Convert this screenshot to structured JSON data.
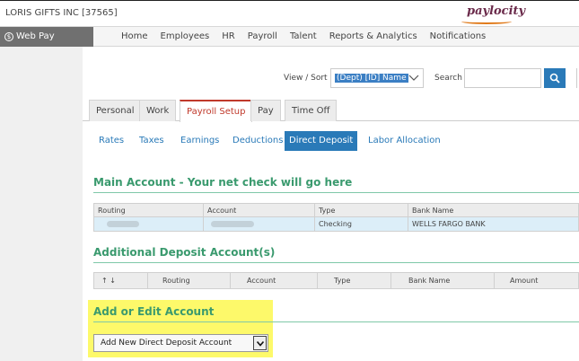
{
  "header": {
    "company": "LORIS GIFTS INC [37565]",
    "logo": "paylocity"
  },
  "navbar": {
    "product": "Web Pay",
    "items": [
      "Home",
      "Employees",
      "HR",
      "Payroll",
      "Talent",
      "Reports & Analytics",
      "Notifications"
    ]
  },
  "toolbar": {
    "view_sort_label": "View / Sort",
    "view_sort_value": "(Dept) [ID] Name",
    "search_label": "Search",
    "search_value": ""
  },
  "tabs": [
    "Personal",
    "Work",
    "Payroll Setup",
    "Pay",
    "Time Off"
  ],
  "active_tab": "Payroll Setup",
  "subtabs": [
    "Rates",
    "Taxes",
    "Earnings",
    "Deductions",
    "Direct Deposit",
    "Labor Allocation"
  ],
  "active_subtab": "Direct Deposit",
  "main_account": {
    "title": "Main Account - Your net check will go here",
    "columns": [
      "Routing",
      "Account",
      "Type",
      "Bank Name"
    ],
    "rows": [
      {
        "type": "Checking",
        "bank_name": "WELLS FARGO BANK"
      }
    ]
  },
  "additional_accounts": {
    "title": "Additional Deposit Account(s)",
    "sort_label": "↑ ↓",
    "columns": [
      "Routing",
      "Account",
      "Type",
      "Bank Name",
      "Amount"
    ]
  },
  "add_edit": {
    "title": "Add or Edit Account",
    "select_value": "Add New Direct Deposit Account"
  },
  "colors": {
    "accent_blue": "#2a7ab8",
    "section_green": "#3a9a6e",
    "active_tab_red": "#c0392b",
    "highlight_yellow": "#fdf96a"
  }
}
